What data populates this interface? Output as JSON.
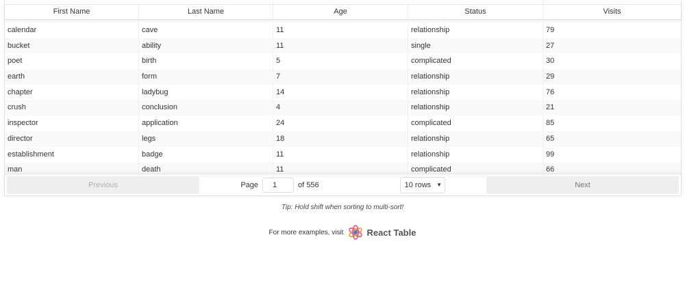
{
  "columns": [
    "First Name",
    "Last Name",
    "Age",
    "Status",
    "Visits"
  ],
  "rows": [
    [
      "calendar",
      "cave",
      "11",
      "relationship",
      "79"
    ],
    [
      "bucket",
      "ability",
      "11",
      "single",
      "27"
    ],
    [
      "poet",
      "birth",
      "5",
      "complicated",
      "30"
    ],
    [
      "earth",
      "form",
      "7",
      "relationship",
      "29"
    ],
    [
      "chapter",
      "ladybug",
      "14",
      "relationship",
      "76"
    ],
    [
      "crush",
      "conclusion",
      "4",
      "relationship",
      "21"
    ],
    [
      "inspector",
      "application",
      "24",
      "complicated",
      "85"
    ],
    [
      "director",
      "legs",
      "18",
      "relationship",
      "65"
    ],
    [
      "establishment",
      "badge",
      "11",
      "relationship",
      "99"
    ],
    [
      "man",
      "death",
      "11",
      "complicated",
      "66"
    ]
  ],
  "pagination": {
    "previous_label": "Previous",
    "next_label": "Next",
    "page_label": "Page",
    "current_page": "1",
    "of_label": "of 556",
    "rows_option": "10 rows"
  },
  "tip": "Tip: Hold shift when sorting to multi-sort!",
  "more_examples": "For more examples, visit",
  "brand_name": "React Table",
  "icons": {
    "logo": "react-logo-icon",
    "select_arrow": "caret-down-icon"
  },
  "colors": {
    "logo_ring": "#e35e8b",
    "logo_core": "#3b82c4",
    "button_bg": "#eeeeee",
    "stripe": "#f9f9f9"
  }
}
